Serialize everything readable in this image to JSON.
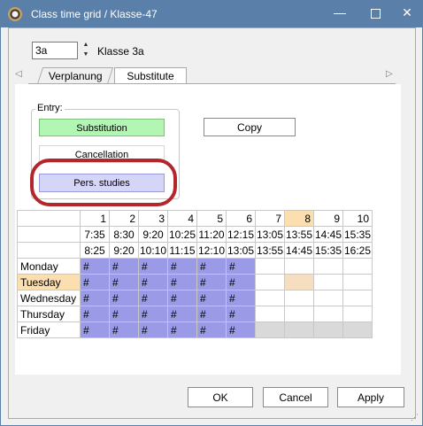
{
  "window": {
    "title": "Class time grid / Klasse-47",
    "min_glyph": "—",
    "close_glyph": "✕"
  },
  "class_selector": {
    "value": "3a",
    "label": "Klasse 3a",
    "up_glyph": "▲",
    "down_glyph": "▼"
  },
  "tabs": [
    {
      "label": "Verplanung"
    },
    {
      "label": "Substitute"
    }
  ],
  "nav": {
    "left_glyph": "◁",
    "right_glyph": "▷"
  },
  "entry": {
    "legend": "Entry:",
    "substitution": "Substitution",
    "cancellation": "Cancellation",
    "pers_studies": "Pers. studies",
    "copy": "Copy"
  },
  "grid": {
    "periods": [
      "1",
      "2",
      "3",
      "4",
      "5",
      "6",
      "7",
      "8",
      "9",
      "10"
    ],
    "start_times": [
      "7:35",
      "8:30",
      "9:20",
      "10:25",
      "11:20",
      "12:15",
      "13:05",
      "13:55",
      "14:45",
      "15:35"
    ],
    "end_times": [
      "8:25",
      "9:20",
      "10:10",
      "11:15",
      "12:10",
      "13:05",
      "13:55",
      "14:45",
      "15:35",
      "16:25"
    ],
    "days": [
      {
        "name": "Monday",
        "cells": [
          "#",
          "#",
          "#",
          "#",
          "#",
          "#",
          "",
          "",
          "",
          ""
        ],
        "types": [
          "hash",
          "hash",
          "hash",
          "hash",
          "hash",
          "hash",
          "white",
          "white",
          "white",
          "white"
        ]
      },
      {
        "name": "Tuesday",
        "cells": [
          "#",
          "#",
          "#",
          "#",
          "#",
          "#",
          "",
          "",
          "",
          ""
        ],
        "types": [
          "hash",
          "hash",
          "hash",
          "hash",
          "hash",
          "hash",
          "white",
          "tan",
          "white",
          "white"
        ]
      },
      {
        "name": "Wednesday",
        "cells": [
          "#",
          "#",
          "#",
          "#",
          "#",
          "#",
          "",
          "",
          "",
          ""
        ],
        "types": [
          "hash",
          "hash",
          "hash",
          "hash",
          "hash",
          "hash",
          "white",
          "white",
          "white",
          "white"
        ]
      },
      {
        "name": "Thursday",
        "cells": [
          "#",
          "#",
          "#",
          "#",
          "#",
          "#",
          "",
          "",
          "",
          ""
        ],
        "types": [
          "hash",
          "hash",
          "hash",
          "hash",
          "hash",
          "hash",
          "white",
          "white",
          "white",
          "white"
        ]
      },
      {
        "name": "Friday",
        "cells": [
          "#",
          "#",
          "#",
          "#",
          "#",
          "#",
          "",
          "",
          "",
          ""
        ],
        "types": [
          "hash",
          "hash",
          "hash",
          "hash",
          "hash",
          "hash",
          "grey",
          "grey",
          "grey",
          "grey"
        ]
      }
    ],
    "highlight_day": "Tuesday",
    "highlight_period": "8"
  },
  "buttons": {
    "ok": "OK",
    "cancel": "Cancel",
    "apply": "Apply"
  },
  "colors": {
    "title_bar": "#5a7fa8",
    "substitution": "#b3f5b3",
    "pers_studies": "#d5d5f8",
    "hash_cell": "#9a9ae6",
    "annotation_ring": "#b3262c"
  }
}
